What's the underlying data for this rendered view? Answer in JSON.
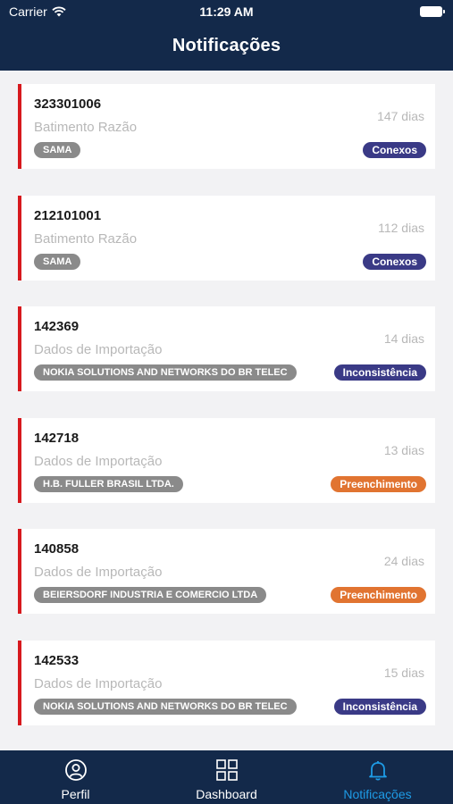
{
  "status_bar": {
    "carrier": "Carrier",
    "time": "11:29 AM"
  },
  "header": {
    "title": "Notificações"
  },
  "notifications": [
    {
      "code": "323301006",
      "subtitle": "Batimento Razão",
      "days": "147 dias",
      "company": "SAMA",
      "tag": "Conexos",
      "tag_color": "#3a3a86"
    },
    {
      "code": "212101001",
      "subtitle": "Batimento Razão",
      "days": "112 dias",
      "company": "SAMA",
      "tag": "Conexos",
      "tag_color": "#3a3a86"
    },
    {
      "code": "142369",
      "subtitle": "Dados de Importação",
      "days": "14 dias",
      "company": "NOKIA SOLUTIONS AND NETWORKS DO BR TELEC",
      "tag": "Inconsistência",
      "tag_color": "#3a3a86"
    },
    {
      "code": "142718",
      "subtitle": "Dados de Importação",
      "days": "13 dias",
      "company": "H.B. FULLER BRASIL LTDA.",
      "tag": "Preenchimento",
      "tag_color": "#e17431"
    },
    {
      "code": "140858",
      "subtitle": "Dados de Importação",
      "days": "24 dias",
      "company": "BEIERSDORF INDUSTRIA E COMERCIO LTDA",
      "tag": "Preenchimento",
      "tag_color": "#e17431"
    },
    {
      "code": "142533",
      "subtitle": "Dados de Importação",
      "days": "15 dias",
      "company": "NOKIA SOLUTIONS AND NETWORKS DO BR TELEC",
      "tag": "Inconsistência",
      "tag_color": "#3a3a86"
    }
  ],
  "tabs": [
    {
      "label": "Perfil",
      "icon": "profile-icon",
      "active": false
    },
    {
      "label": "Dashboard",
      "icon": "dashboard-icon",
      "active": false
    },
    {
      "label": "Notificações",
      "icon": "bell-icon",
      "active": true
    }
  ],
  "colors": {
    "header_bg": "#13294a",
    "accent_red": "#d7191e",
    "active_tab": "#1e9be6"
  }
}
